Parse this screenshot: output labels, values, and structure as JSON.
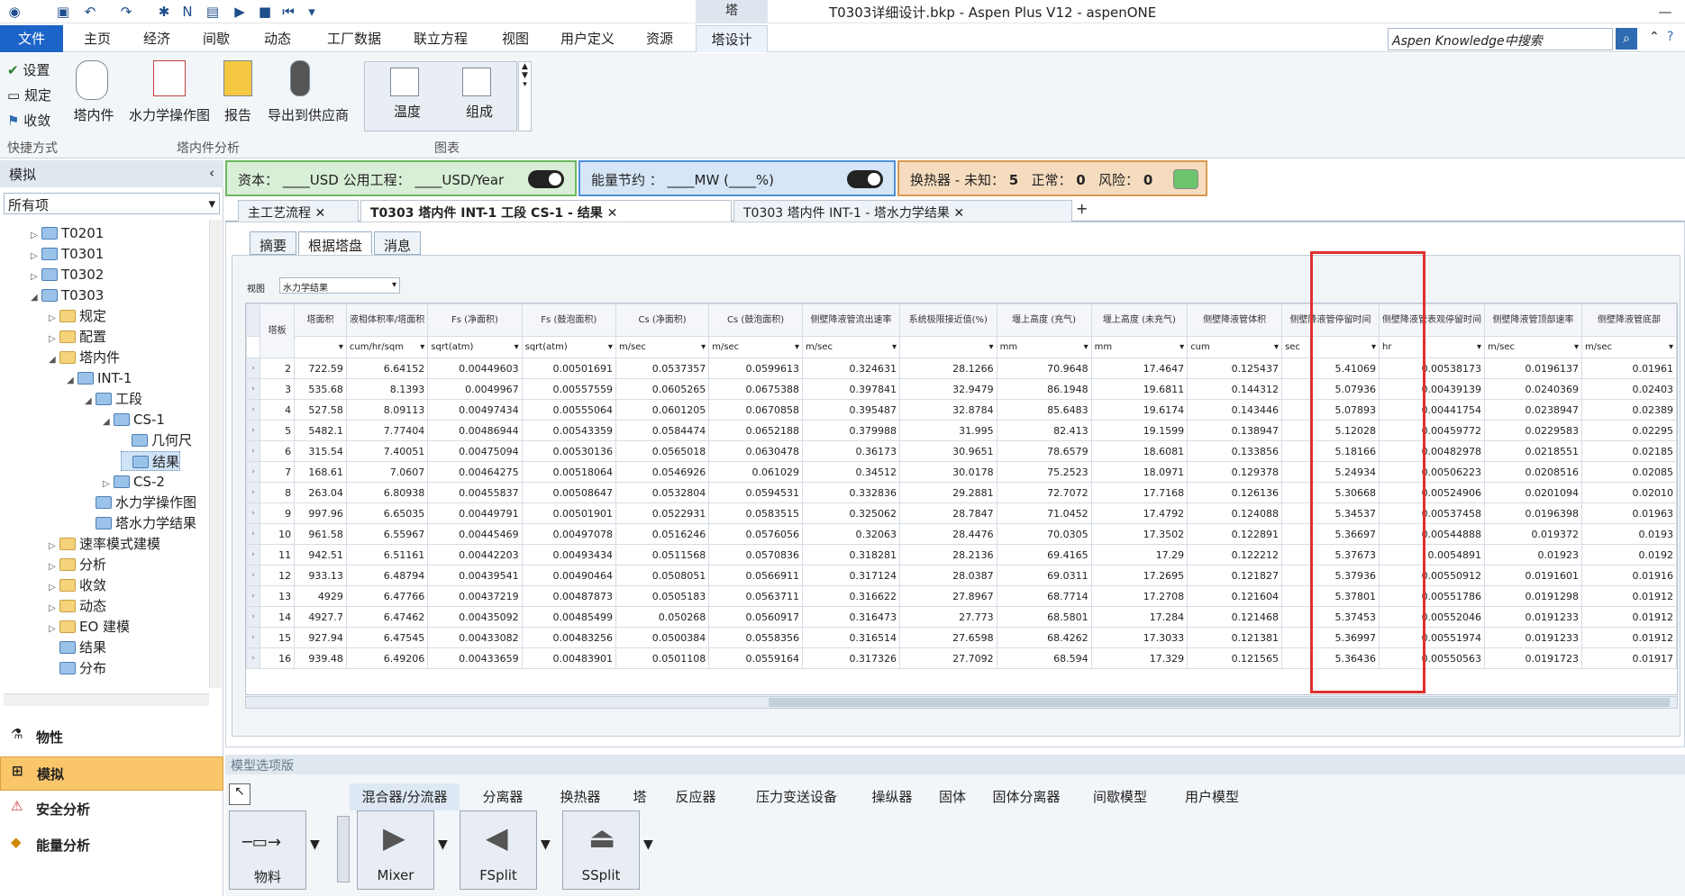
{
  "window": {
    "title": "T0303详细设计.bkp - Aspen Plus V12 - aspenONE",
    "context_tab": "塔"
  },
  "menu": {
    "items": [
      "文件",
      "主页",
      "经济",
      "间歇",
      "动态",
      "工厂数据",
      "联立方程",
      "视图",
      "用户定义",
      "资源",
      "塔设计"
    ],
    "search_placeholder": "Aspen Knowledge中搜索"
  },
  "ribbon": {
    "quick": {
      "setup": "设置",
      "spec": "规定",
      "converge": "收敛",
      "group": "快捷方式"
    },
    "internals": {
      "internals": "塔内件",
      "hydraulic": "水力学操作图",
      "report": "报告",
      "export": "导出到供应商",
      "group": "塔内件分析"
    },
    "plots": {
      "temp": "温度",
      "comp": "组成",
      "group": "图表"
    }
  },
  "left": {
    "header": "模拟",
    "filter": "所有项",
    "tree": [
      {
        "label": "T0201",
        "lvl": 1,
        "tg": "▷",
        "ic": "blue"
      },
      {
        "label": "T0301",
        "lvl": 1,
        "tg": "▷",
        "ic": "blue"
      },
      {
        "label": "T0302",
        "lvl": 1,
        "tg": "▷",
        "ic": "blue"
      },
      {
        "label": "T0303",
        "lvl": 1,
        "tg": "◢",
        "ic": "blue"
      },
      {
        "label": "规定",
        "lvl": 2,
        "tg": "▷",
        "ic": "folder"
      },
      {
        "label": "配置",
        "lvl": 2,
        "tg": "▷",
        "ic": "folder"
      },
      {
        "label": "塔内件",
        "lvl": 2,
        "tg": "◢",
        "ic": "folder"
      },
      {
        "label": "INT-1",
        "lvl": 3,
        "tg": "◢",
        "ic": "blue"
      },
      {
        "label": "工段",
        "lvl": 4,
        "tg": "◢",
        "ic": "blue"
      },
      {
        "label": "CS-1",
        "lvl": 5,
        "tg": "◢",
        "ic": "blue"
      },
      {
        "label": "几何尺",
        "lvl": 6,
        "tg": "",
        "ic": "blue"
      },
      {
        "label": "结果",
        "lvl": 6,
        "tg": "",
        "ic": "blue",
        "sel": true
      },
      {
        "label": "CS-2",
        "lvl": 5,
        "tg": "▷",
        "ic": "blue"
      },
      {
        "label": "水力学操作图",
        "lvl": 4,
        "tg": "",
        "ic": "blue"
      },
      {
        "label": "塔水力学结果",
        "lvl": 4,
        "tg": "",
        "ic": "blue"
      },
      {
        "label": "速率模式建模",
        "lvl": 2,
        "tg": "▷",
        "ic": "folder"
      },
      {
        "label": "分析",
        "lvl": 2,
        "tg": "▷",
        "ic": "folder"
      },
      {
        "label": "收敛",
        "lvl": 2,
        "tg": "▷",
        "ic": "folder"
      },
      {
        "label": "动态",
        "lvl": 2,
        "tg": "▷",
        "ic": "folder"
      },
      {
        "label": "EO 建模",
        "lvl": 2,
        "tg": "▷",
        "ic": "folder"
      },
      {
        "label": "结果",
        "lvl": 2,
        "tg": "",
        "ic": "blue"
      },
      {
        "label": "分布",
        "lvl": 2,
        "tg": "",
        "ic": "blue"
      }
    ],
    "nav": [
      "物性",
      "模拟",
      "安全分析",
      "能量分析"
    ]
  },
  "status": {
    "capital": "资本：  ____USD   公用工程：  ____USD/Year",
    "energy": "能量节约 ：  ____MW    (____%)",
    "hx_label": "换热器 - 未知：",
    "hx_unknown": "5",
    "normal_label": "正常：",
    "normal": "0",
    "risk_label": "风险：",
    "risk": "0"
  },
  "doctabs": [
    "主工艺流程",
    "T0303 塔内件 INT-1 工段 CS-1 - 结果",
    "T0303 塔内件 INT-1 - 塔水力学结果"
  ],
  "subtabs": [
    "摘要",
    "根据塔盘",
    "消息"
  ],
  "view": {
    "label": "视图",
    "value": "水力学结果"
  },
  "grid": {
    "stage_header": "塔板",
    "columns": [
      {
        "h": "塔面积",
        "u": ""
      },
      {
        "h": "液相体积率/塔面积",
        "u": "cum/hr/sqm"
      },
      {
        "h": "Fs (净面积)",
        "u": "sqrt(atm)"
      },
      {
        "h": "Fs (鼓泡面积)",
        "u": "sqrt(atm)"
      },
      {
        "h": "Cs (净面积)",
        "u": "m/sec"
      },
      {
        "h": "Cs (鼓泡面积)",
        "u": "m/sec"
      },
      {
        "h": "侧壁降液管流出速率",
        "u": "m/sec"
      },
      {
        "h": "系统极限接近值(%)",
        "u": ""
      },
      {
        "h": "堰上高度 (充气)",
        "u": "mm"
      },
      {
        "h": "堰上高度 (未充气)",
        "u": "mm"
      },
      {
        "h": "侧壁降液管体积",
        "u": "cum"
      },
      {
        "h": "侧壁降液管停留时间",
        "u": "sec"
      },
      {
        "h": "侧壁降液管表观停留时间",
        "u": "hr"
      },
      {
        "h": "侧壁降液管顶部速率",
        "u": "m/sec"
      },
      {
        "h": "侧壁降液管底部",
        "u": "m/sec"
      }
    ],
    "rows": [
      [
        "2",
        "722.59",
        "6.64152",
        "0.00449603",
        "0.00501691",
        "0.0537357",
        "0.0599613",
        "0.324631",
        "28.1266",
        "70.9648",
        "17.4647",
        "0.125437",
        "5.41069",
        "0.00538173",
        "0.0196137",
        "0.01961"
      ],
      [
        "3",
        "535.68",
        "8.1393",
        "0.0049967",
        "0.00557559",
        "0.0605265",
        "0.0675388",
        "0.397841",
        "32.9479",
        "86.1948",
        "19.6811",
        "0.144312",
        "5.07936",
        "0.00439139",
        "0.0240369",
        "0.02403"
      ],
      [
        "4",
        "527.58",
        "8.09113",
        "0.00497434",
        "0.00555064",
        "0.0601205",
        "0.0670858",
        "0.395487",
        "32.8784",
        "85.6483",
        "19.6174",
        "0.143446",
        "5.07893",
        "0.00441754",
        "0.0238947",
        "0.02389"
      ],
      [
        "5",
        "5482.1",
        "7.77404",
        "0.00486944",
        "0.00543359",
        "0.0584474",
        "0.0652188",
        "0.379988",
        "31.995",
        "82.413",
        "19.1599",
        "0.138947",
        "5.12028",
        "0.00459772",
        "0.0229583",
        "0.02295"
      ],
      [
        "6",
        "315.54",
        "7.40051",
        "0.00475094",
        "0.00530136",
        "0.0565018",
        "0.0630478",
        "0.36173",
        "30.9651",
        "78.6579",
        "18.6081",
        "0.133856",
        "5.18166",
        "0.00482978",
        "0.0218551",
        "0.02185"
      ],
      [
        "7",
        "168.61",
        "7.0607",
        "0.00464275",
        "0.00518064",
        "0.0546926",
        "0.061029",
        "0.34512",
        "30.0178",
        "75.2523",
        "18.0971",
        "0.129378",
        "5.24934",
        "0.00506223",
        "0.0208516",
        "0.02085"
      ],
      [
        "8",
        "263.04",
        "6.80938",
        "0.00455837",
        "0.00508647",
        "0.0532804",
        "0.0594531",
        "0.332836",
        "29.2881",
        "72.7072",
        "17.7168",
        "0.126136",
        "5.30668",
        "0.00524906",
        "0.0201094",
        "0.02010"
      ],
      [
        "9",
        "997.96",
        "6.65035",
        "0.00449791",
        "0.00501901",
        "0.0522931",
        "0.0583515",
        "0.325062",
        "28.7847",
        "71.0452",
        "17.4792",
        "0.124088",
        "5.34537",
        "0.00537458",
        "0.0196398",
        "0.01963"
      ],
      [
        "10",
        "961.58",
        "6.55967",
        "0.00445469",
        "0.00497078",
        "0.0516246",
        "0.0576056",
        "0.32063",
        "28.4476",
        "70.0305",
        "17.3502",
        "0.122891",
        "5.36697",
        "0.00544888",
        "0.019372",
        "0.0193"
      ],
      [
        "11",
        "942.51",
        "6.51161",
        "0.00442203",
        "0.00493434",
        "0.0511568",
        "0.0570836",
        "0.318281",
        "28.2136",
        "69.4165",
        "17.29",
        "0.122212",
        "5.37673",
        "0.0054891",
        "0.01923",
        "0.0192"
      ],
      [
        "12",
        "933.13",
        "6.48794",
        "0.00439541",
        "0.00490464",
        "0.0508051",
        "0.0566911",
        "0.317124",
        "28.0387",
        "69.0311",
        "17.2695",
        "0.121827",
        "5.37936",
        "0.00550912",
        "0.0191601",
        "0.01916"
      ],
      [
        "13",
        "4929",
        "6.47766",
        "0.00437219",
        "0.00487873",
        "0.0505183",
        "0.0563711",
        "0.316622",
        "27.8967",
        "68.7714",
        "17.2708",
        "0.121604",
        "5.37801",
        "0.00551786",
        "0.0191298",
        "0.01912"
      ],
      [
        "14",
        "4927.7",
        "6.47462",
        "0.00435092",
        "0.00485499",
        "0.050268",
        "0.0560917",
        "0.316473",
        "27.773",
        "68.5801",
        "17.284",
        "0.121468",
        "5.37453",
        "0.00552046",
        "0.0191233",
        "0.01912"
      ],
      [
        "15",
        "927.94",
        "6.47545",
        "0.00433082",
        "0.00483256",
        "0.0500384",
        "0.0558356",
        "0.316514",
        "27.6598",
        "68.4262",
        "17.3033",
        "0.121381",
        "5.36997",
        "0.00551974",
        "0.0191233",
        "0.01912"
      ],
      [
        "16",
        "939.48",
        "6.49206",
        "0.00433659",
        "0.00483901",
        "0.0501108",
        "0.0559164",
        "0.317326",
        "27.7092",
        "68.594",
        "17.329",
        "0.121565",
        "5.36436",
        "0.00550563",
        "0.0191723",
        "0.01917"
      ]
    ]
  },
  "palette": {
    "header": "模型选项版",
    "tabs": [
      "混合器/分流器",
      "分离器",
      "换热器",
      "塔",
      "反应器",
      "压力变送设备",
      "操纵器",
      "固体",
      "固体分离器",
      "间歇模型",
      "用户模型"
    ],
    "items": [
      "物料",
      "Mixer",
      "FSplit",
      "SSplit"
    ]
  }
}
